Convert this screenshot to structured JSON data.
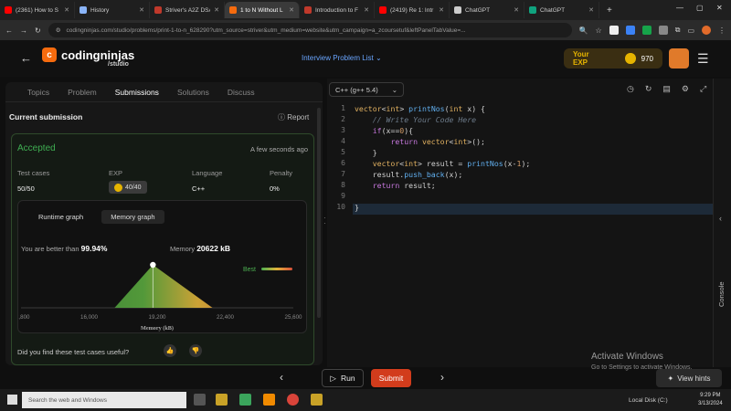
{
  "browser": {
    "tabs": [
      {
        "label": "(2361) How to S",
        "color": "#ff0000"
      },
      {
        "label": "History",
        "color": "#8ab4f8"
      },
      {
        "label": "Striver's A2Z DSA",
        "color": "#c0392b"
      },
      {
        "label": "1 to N Without L",
        "color": "#f66b0e",
        "active": true
      },
      {
        "label": "Introduction to F",
        "color": "#c0392b"
      },
      {
        "label": "(2419) Re 1: Intr",
        "color": "#ff0000"
      },
      {
        "label": "ChatGPT",
        "color": "#cccccc"
      },
      {
        "label": "ChatGPT",
        "color": "#10a37f"
      }
    ],
    "new_tab": "+",
    "url": "codingninjas.com/studio/problems/print-1-to-n_628290?utm_source=striver&utm_medium=website&utm_campaign=a_zcoursetuf&leftPanelTabValue=..."
  },
  "header": {
    "logo_name": "codingninjas",
    "logo_sub": "/studio",
    "problem_list": "Interview Problem List",
    "exp_label": "Your EXP",
    "exp_value": "970"
  },
  "left": {
    "tabs": [
      "Topics",
      "Problem",
      "Submissions",
      "Solutions",
      "Discuss"
    ],
    "active_tab": 2,
    "current_submission": "Current submission",
    "report": "Report",
    "status": "Accepted",
    "time": "A few seconds ago",
    "stats": {
      "test_cases_h": "Test cases",
      "test_cases_v": "50/50",
      "exp_h": "EXP",
      "exp_v": "40/40",
      "language_h": "Language",
      "language_v": "C++",
      "penalty_h": "Penalty",
      "penalty_v": "0%"
    },
    "graph_tabs": [
      "Runtime graph",
      "Memory graph"
    ],
    "better_label": "You are better than",
    "better_value": "99.94%",
    "memory_label": "Memory",
    "memory_value": "20622 kB",
    "useful": "Did you find these test cases useful?"
  },
  "chart_data": {
    "type": "area",
    "xlabel": "Memory (kB)",
    "x_ticks": [
      "12,800",
      "16,000",
      "19,200",
      "22,400",
      "25,600"
    ],
    "x_range": [
      12800,
      25600
    ],
    "series": [
      {
        "x": [
          12800,
          17200,
          19000,
          21800,
          25600
        ],
        "values": [
          0,
          0,
          100,
          0,
          0
        ]
      }
    ],
    "marker_x": 19000,
    "legend": "Best"
  },
  "editor": {
    "language": "C++ (g++ 5.4)",
    "lines": [
      "1",
      "2",
      "3",
      "4",
      "5",
      "6",
      "7",
      "8",
      "9",
      "10"
    ]
  },
  "console_label": "Console",
  "bottom": {
    "run": "Run",
    "submit": "Submit",
    "activate_title": "Activate Windows",
    "activate_sub": "Go to Settings to activate Windows.",
    "view_hints": "View hints"
  },
  "taskbar": {
    "search": "Search the web and Windows",
    "disk": "Local Disk (C:)",
    "time": "9:29 PM",
    "date": "3/13/2024"
  }
}
